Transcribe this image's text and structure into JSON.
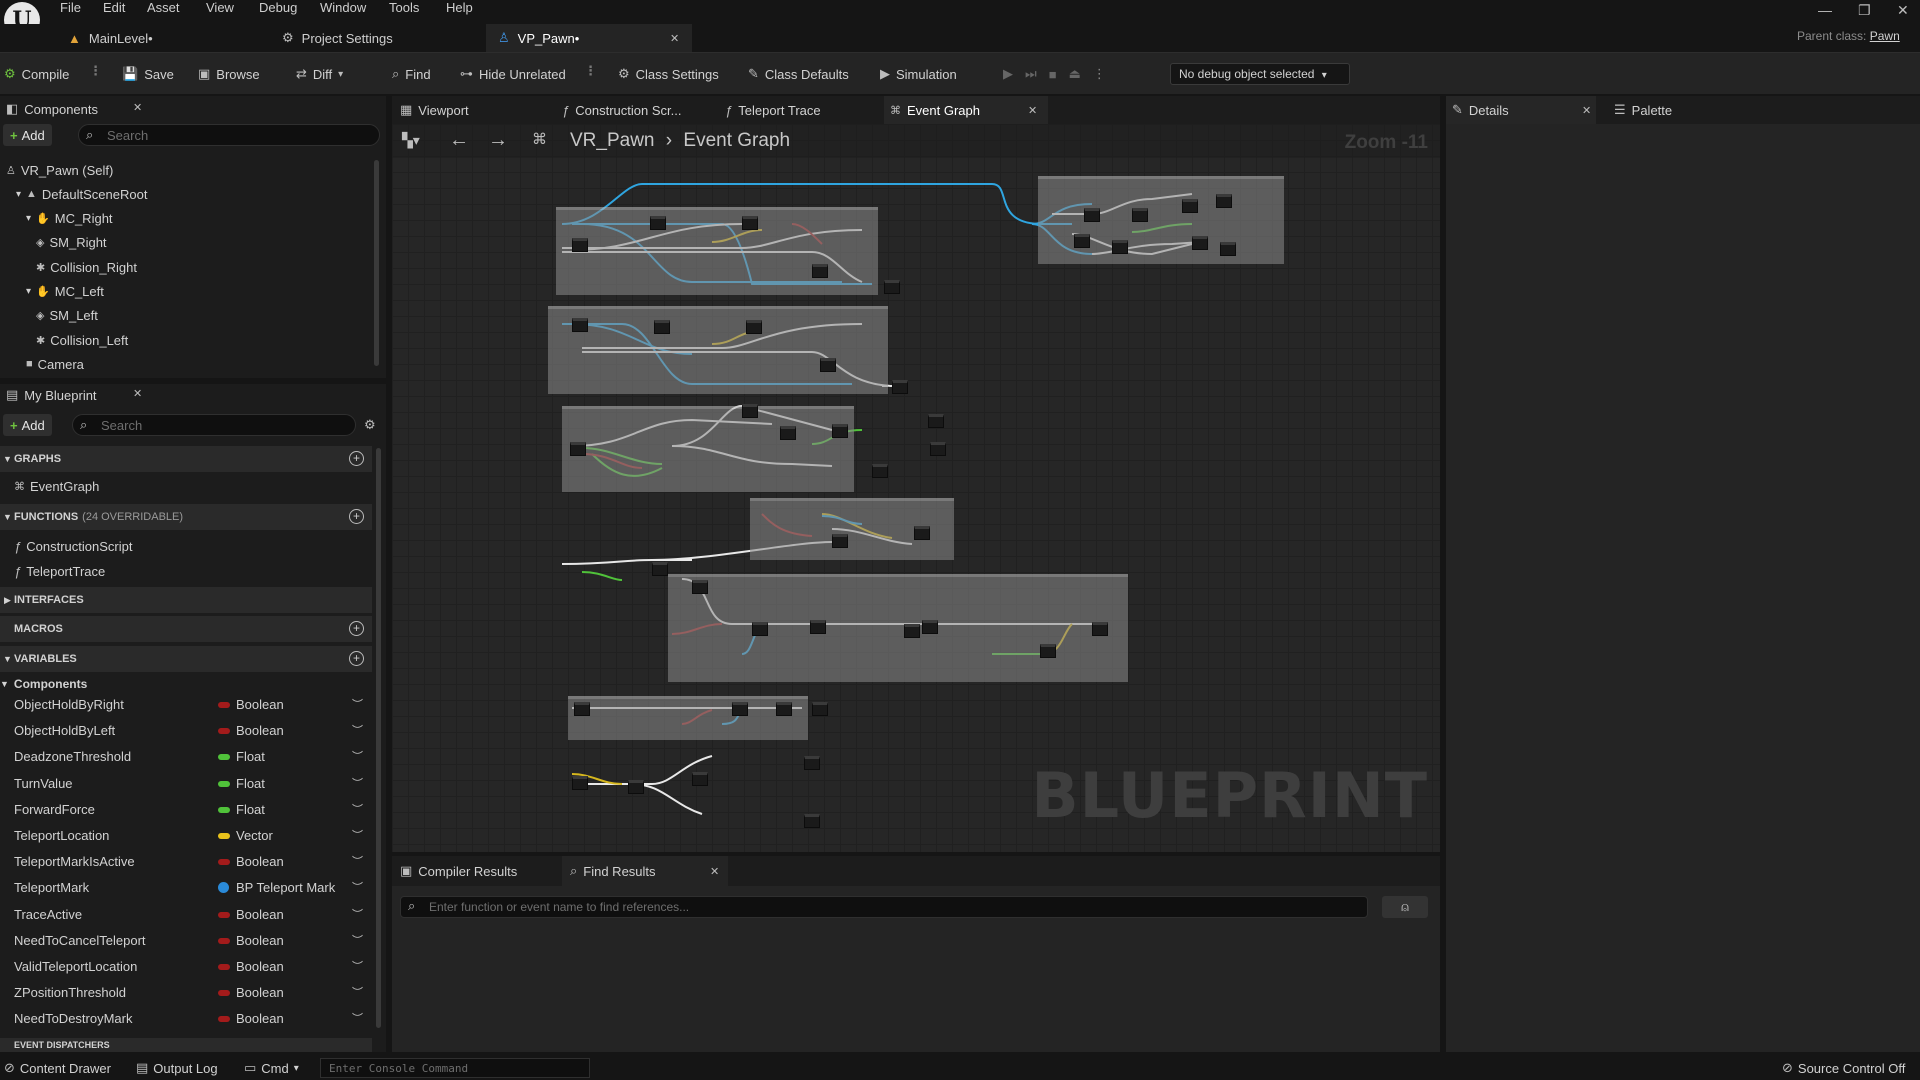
{
  "menu": {
    "items": [
      "File",
      "Edit",
      "Asset",
      "View",
      "Debug",
      "Window",
      "Tools",
      "Help"
    ]
  },
  "doc_tabs": [
    {
      "label": "MainLevel•",
      "icon": "level-icon"
    },
    {
      "label": "Project Settings",
      "icon": "gear-icon"
    },
    {
      "label": "VP_Pawn•",
      "icon": "pawn-icon",
      "active": true
    }
  ],
  "parent_class": {
    "label": "Parent class:",
    "value": "Pawn"
  },
  "toolbar": {
    "compile": "Compile",
    "save": "Save",
    "browse": "Browse",
    "diff": "Diff",
    "find": "Find",
    "hide_unrelated": "Hide Unrelated",
    "class_settings": "Class Settings",
    "class_defaults": "Class Defaults",
    "simulation": "Simulation",
    "debug_object": "No debug object selected"
  },
  "components_panel": {
    "title": "Components",
    "add": "Add",
    "search_placeholder": "Search",
    "tree": [
      {
        "label": "VR_Pawn (Self)",
        "depth": 0
      },
      {
        "label": "DefaultSceneRoot",
        "depth": 1
      },
      {
        "label": "MC_Right",
        "depth": 2
      },
      {
        "label": "SM_Right",
        "depth": 3
      },
      {
        "label": "Collision_Right",
        "depth": 3
      },
      {
        "label": "MC_Left",
        "depth": 2
      },
      {
        "label": "SM_Left",
        "depth": 3
      },
      {
        "label": "Collision_Left",
        "depth": 3
      },
      {
        "label": "Camera",
        "depth": 2
      }
    ]
  },
  "my_blueprint": {
    "title": "My Blueprint",
    "add": "Add",
    "search_placeholder": "Search",
    "graphs_header": "GRAPHS",
    "graphs": [
      "EventGraph"
    ],
    "functions_header": "FUNCTIONS",
    "functions_sub": "(24 OVERRIDABLE)",
    "functions": [
      "ConstructionScript",
      "TeleportTrace"
    ],
    "interfaces_header": "INTERFACES",
    "macros_header": "MACROS",
    "variables_header": "VARIABLES",
    "components_label": "Components",
    "variables": [
      {
        "name": "ObjectHoldByRight",
        "type": "Boolean",
        "color": "#a31b1b"
      },
      {
        "name": "ObjectHoldByLeft",
        "type": "Boolean",
        "color": "#a31b1b"
      },
      {
        "name": "DeadzoneThreshold",
        "type": "Float",
        "color": "#50c23a"
      },
      {
        "name": "TurnValue",
        "type": "Float",
        "color": "#50c23a"
      },
      {
        "name": "ForwardForce",
        "type": "Float",
        "color": "#50c23a"
      },
      {
        "name": "TeleportLocation",
        "type": "Vector",
        "color": "#e9c21b"
      },
      {
        "name": "TeleportMarkIsActive",
        "type": "Boolean",
        "color": "#a31b1b"
      },
      {
        "name": "TeleportMark",
        "type": "BP Teleport Mark",
        "color": "#2a8ad8"
      },
      {
        "name": "TraceActive",
        "type": "Boolean",
        "color": "#a31b1b"
      },
      {
        "name": "NeedToCancelTeleport",
        "type": "Boolean",
        "color": "#a31b1b"
      },
      {
        "name": "ValidTeleportLocation",
        "type": "Boolean",
        "color": "#a31b1b"
      },
      {
        "name": "ZPositionThreshold",
        "type": "Boolean",
        "color": "#a31b1b"
      },
      {
        "name": "NeedToDestroyMark",
        "type": "Boolean",
        "color": "#a31b1b"
      }
    ],
    "event_dispatchers_header": "EVENT DISPATCHERS"
  },
  "graph_tabs": [
    "Viewport",
    "Construction Scr...",
    "Teleport Trace",
    "Event Graph"
  ],
  "breadcrumb": {
    "root": "VR_Pawn",
    "current": "Event Graph"
  },
  "zoom": "Zoom -11",
  "watermark": "BLUEPRINT",
  "details_panel": {
    "details": "Details",
    "palette": "Palette"
  },
  "bottom_tabs": {
    "compiler": "Compiler Results",
    "find": "Find Results"
  },
  "find_placeholder": "Enter function or event name to find references...",
  "statusbar": {
    "content_drawer": "Content Drawer",
    "output_log": "Output Log",
    "cmd": "Cmd",
    "console_placeholder": "Enter Console Command",
    "source_control": "Source Control Off"
  }
}
